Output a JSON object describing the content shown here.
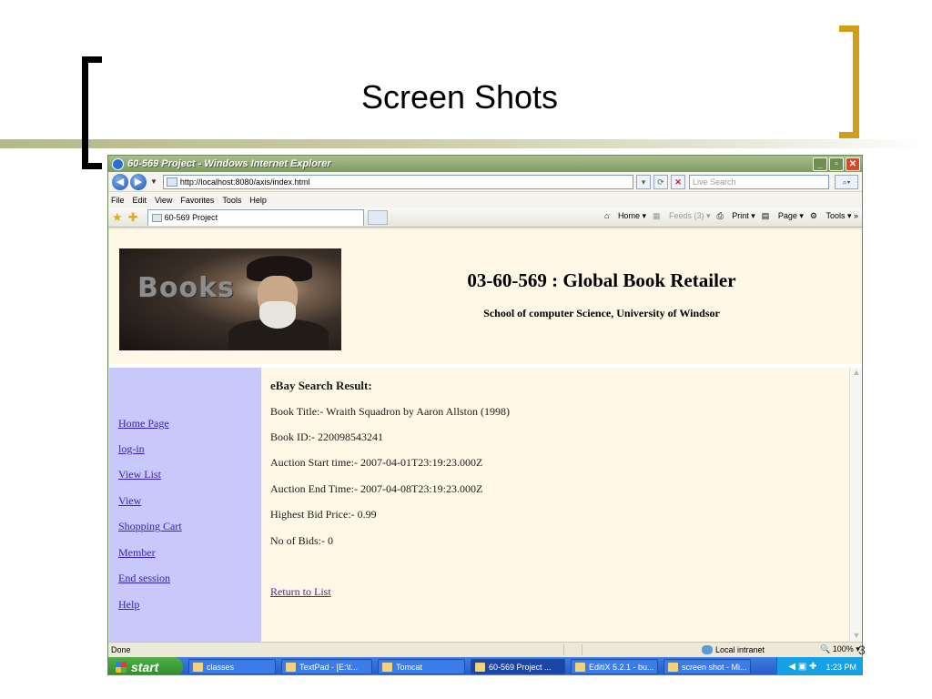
{
  "slide": {
    "title": "Screen Shots",
    "number": "3"
  },
  "browser": {
    "window_title": "60-569 Project - Windows Internet Explorer",
    "address": "http://localhost:8080/axis/index.html",
    "search_placeholder": "Live Search",
    "menu": [
      "File",
      "Edit",
      "View",
      "Favorites",
      "Tools",
      "Help"
    ],
    "tab_title": "60-569 Project",
    "commands": {
      "home": "Home",
      "feeds": "Feeds (3)",
      "print": "Print",
      "page": "Page",
      "tools": "Tools"
    },
    "status": {
      "done": "Done",
      "zone": "Local intranet",
      "zoom": "100%"
    }
  },
  "page": {
    "header_image_text": "Books",
    "title": "03-60-569 : Global Book Retailer",
    "subtitle": "School of computer Science, University of Windsor",
    "nav": [
      "Home Page",
      "log-in",
      "View List",
      "View",
      "Shopping Cart",
      "Member",
      "End session",
      "Help"
    ],
    "result": {
      "heading": "eBay Search Result:",
      "book_title": "Book Title:- Wraith Squadron by Aaron Allston (1998)",
      "book_id": "Book ID:- 220098543241",
      "start_time": "Auction Start time:- 2007-04-01T23:19:23.000Z",
      "end_time": "Auction End Time:- 2007-04-08T23:19:23.000Z",
      "highest_bid": "Highest Bid Price:- 0.99",
      "num_bids": "No of Bids:- 0",
      "return_link": "Return to List"
    }
  },
  "taskbar": {
    "start": "start",
    "items": [
      "classes",
      "TextPad - [E:\\t...",
      "Tomcat",
      "60-569 Project ...",
      "EditiX 5.2.1 - bu...",
      "screen shot - Mi..."
    ],
    "clock": "1:23 PM"
  },
  "colors": {
    "accent_bracket": "#d39d1a",
    "sidebar_bg": "#c8c8fa",
    "page_bg": "#fff8e6",
    "link": "#3a1fb8"
  }
}
